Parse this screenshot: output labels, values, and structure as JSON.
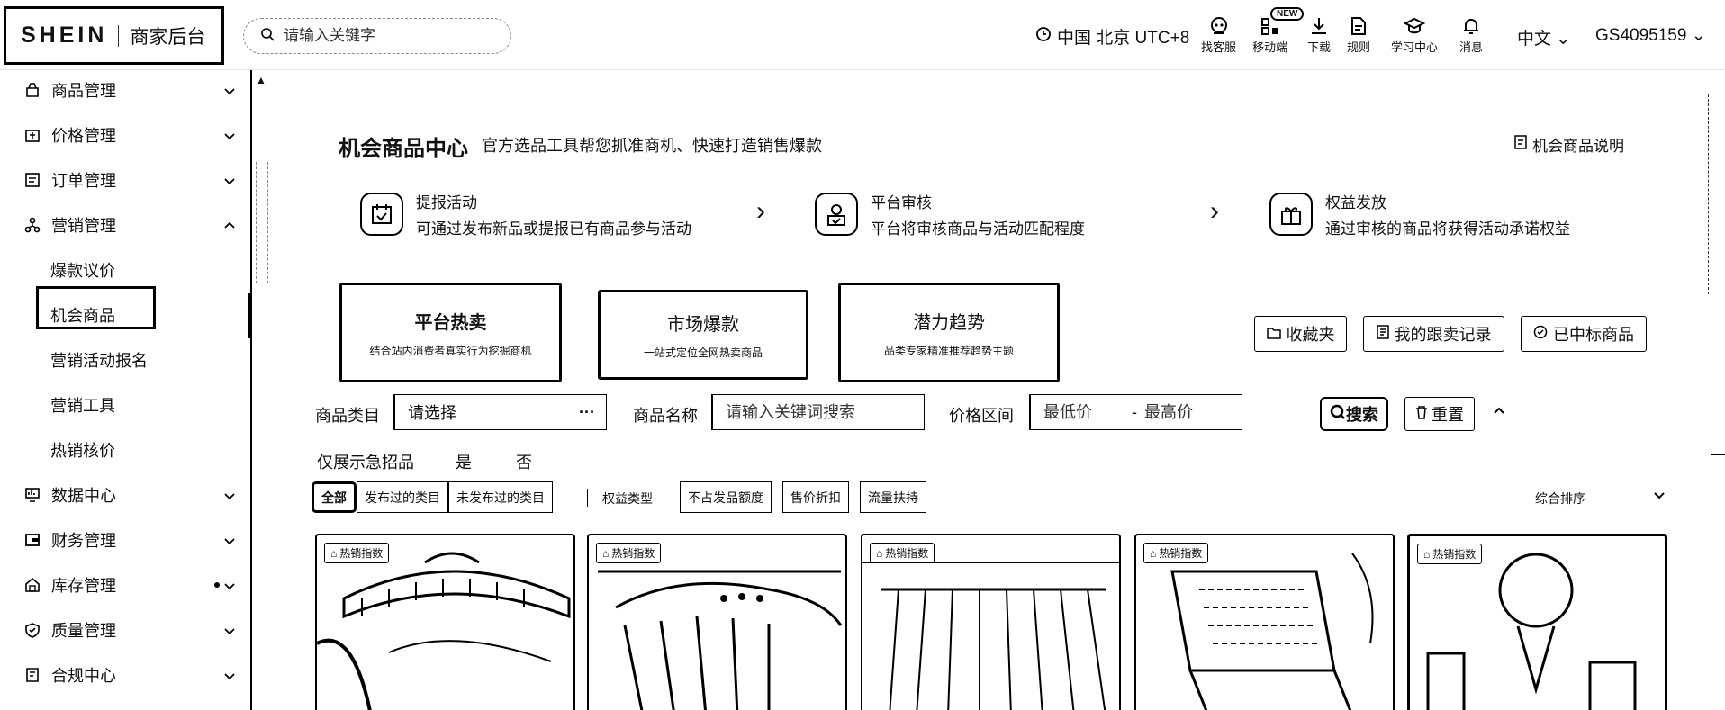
{
  "header": {
    "brand": "SHEIN",
    "brand_sub": "商家后台",
    "search_placeholder": "请输入关键字",
    "timezone": "中国 北京 UTC+8",
    "tools": [
      {
        "label": "找客服",
        "icon": "customer-service-icon"
      },
      {
        "label": "移动端",
        "icon": "mobile-qr-icon"
      },
      {
        "label": "下载",
        "icon": "download-icon"
      },
      {
        "label": "规则",
        "icon": "document-icon"
      },
      {
        "label": "学习中心",
        "icon": "graduation-cap-icon"
      },
      {
        "label": "消息",
        "icon": "bell-icon"
      }
    ],
    "new_badge": "NEW",
    "language": "中文",
    "account": "GS4095159"
  },
  "sidebar": {
    "items": [
      {
        "label": "商品管理",
        "icon": "box-icon",
        "expanded": false
      },
      {
        "label": "价格管理",
        "icon": "price-icon",
        "expanded": false
      },
      {
        "label": "订单管理",
        "icon": "order-list-icon",
        "expanded": false
      },
      {
        "label": "营销管理",
        "icon": "marketing-icon",
        "expanded": true
      }
    ],
    "subitems": [
      "爆款议价",
      "机会商品",
      "营销活动报名",
      "营销工具",
      "热销核价"
    ],
    "active_subitem": "机会商品",
    "items_after": [
      {
        "label": "数据中心",
        "icon": "data-monitor-icon"
      },
      {
        "label": "财务管理",
        "icon": "wallet-icon"
      },
      {
        "label": "库存管理",
        "icon": "warehouse-icon"
      },
      {
        "label": "质量管理",
        "icon": "shield-check-icon"
      },
      {
        "label": "合规中心",
        "icon": "compliance-icon"
      }
    ]
  },
  "main": {
    "title": "机会商品中心",
    "subtitle": "官方选品工具帮您抓准商机、快速打造销售爆款",
    "explain_link": "机会商品说明",
    "steps": [
      {
        "title": "提报活动",
        "desc": "可通过发布新品或提报已有商品参与活动",
        "icon": "submit-activity-icon"
      },
      {
        "title": "平台审核",
        "desc": "平台将审核商品与活动匹配程度",
        "icon": "review-icon"
      },
      {
        "title": "权益发放",
        "desc": "通过审核的商品将获得活动承诺权益",
        "icon": "rights-gift-icon"
      }
    ],
    "tabs": [
      {
        "title": "平台热卖",
        "desc": "结合站内消费者真实行为挖掘商机",
        "active": true
      },
      {
        "title": "市场爆款",
        "desc": "一站式定位全网热卖商品",
        "active": false
      },
      {
        "title": "潜力趋势",
        "desc": "品类专家精准推荐趋势主题",
        "active": false
      }
    ],
    "right_buttons": [
      {
        "label": "收藏夹",
        "icon": "folder-icon"
      },
      {
        "label": "我的跟卖记录",
        "icon": "record-icon"
      },
      {
        "label": "已中标商品",
        "icon": "won-icon"
      }
    ],
    "filters": {
      "category_label": "商品类目",
      "category_placeholder": "请选择",
      "category_more": "···",
      "name_label": "商品名称",
      "name_placeholder": "请输入关键词搜索",
      "price_label": "价格区间",
      "price_min_placeholder": "最低价",
      "price_sep": "-",
      "price_max_placeholder": "最高价",
      "search_btn": "搜索",
      "reset_btn": "重置"
    },
    "urgent": {
      "label": "仅展示急招品",
      "yes": "是",
      "no": "否"
    },
    "chips_group1": [
      "全部",
      "发布过的类目",
      "未发布过的类目"
    ],
    "rights_label": "权益类型",
    "chips_group2": [
      "不占发品额度",
      "售价折扣",
      "流量扶持"
    ],
    "sort_label": "综合排序",
    "products": [
      {
        "badge": "热销指数",
        "subject": "hanger-product"
      },
      {
        "badge": "热销指数",
        "subject": "clothes-rack-product"
      },
      {
        "badge": "热销指数",
        "subject": "shirts-rack-product"
      },
      {
        "badge": "热销指数",
        "subject": "tool-case-product"
      },
      {
        "badge": "热销指数",
        "subject": "ornament-product"
      }
    ]
  }
}
